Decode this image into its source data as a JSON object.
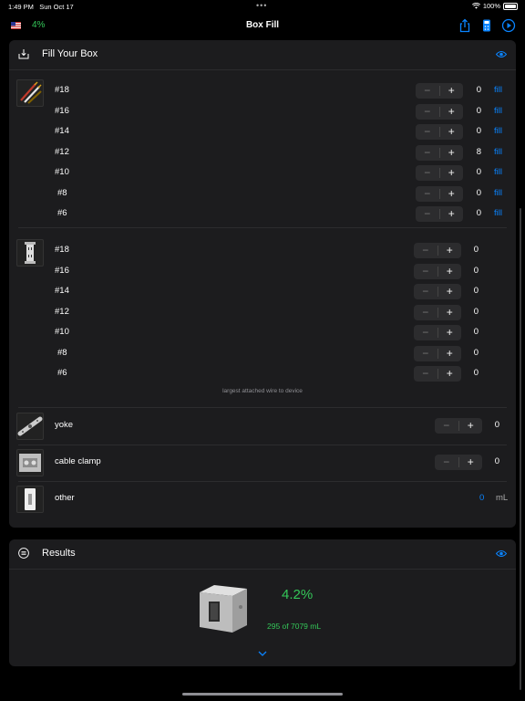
{
  "status": {
    "time": "1:49 PM",
    "date": "Sun Oct 17",
    "battery": "100%"
  },
  "nav": {
    "title": "Box Fill",
    "fill_percent": "4%",
    "flag_icon": "us-flag-icon"
  },
  "fill_section": {
    "title": "Fill Your Box",
    "conductors": [
      {
        "gauge": "#18",
        "count": "0",
        "fill_label": "fill"
      },
      {
        "gauge": "#16",
        "count": "0",
        "fill_label": "fill"
      },
      {
        "gauge": "#14",
        "count": "0",
        "fill_label": "fill"
      },
      {
        "gauge": "#12",
        "count": "8",
        "fill_label": "fill"
      },
      {
        "gauge": "#10",
        "count": "0",
        "fill_label": "fill"
      },
      {
        "gauge": "#8",
        "count": "0",
        "fill_label": "fill"
      },
      {
        "gauge": "#6",
        "count": "0",
        "fill_label": "fill"
      }
    ],
    "devices": [
      {
        "gauge": "#18",
        "count": "0"
      },
      {
        "gauge": "#16",
        "count": "0"
      },
      {
        "gauge": "#14",
        "count": "0"
      },
      {
        "gauge": "#12",
        "count": "0"
      },
      {
        "gauge": "#10",
        "count": "0"
      },
      {
        "gauge": "#8",
        "count": "0"
      },
      {
        "gauge": "#6",
        "count": "0"
      }
    ],
    "device_note": "largest attached wire to device",
    "yoke": {
      "label": "yoke",
      "count": "0"
    },
    "cable_clamp": {
      "label": "cable clamp",
      "count": "0"
    },
    "other": {
      "label": "other",
      "value": "0",
      "unit": "mL"
    }
  },
  "results": {
    "title": "Results",
    "percent": "4.2%",
    "detail": "295 of 7079 mL"
  },
  "colors": {
    "accent": "#0a84ff",
    "green": "#34c759",
    "card": "#1c1c1e"
  }
}
